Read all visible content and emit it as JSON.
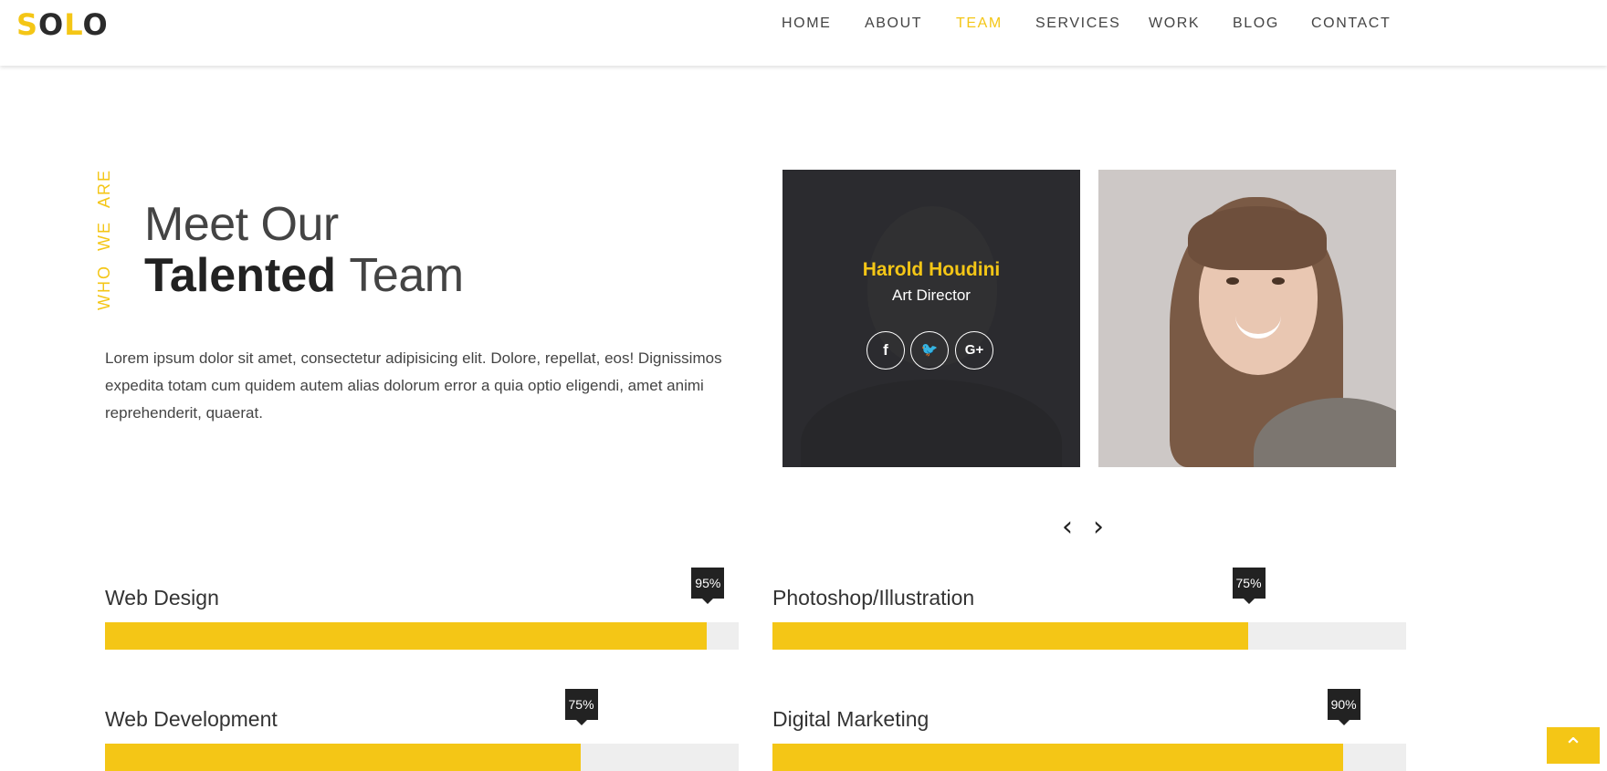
{
  "brand": {
    "letters": [
      "S",
      "O",
      "L",
      "O"
    ],
    "accent_color": "#f4c616"
  },
  "nav": {
    "items": [
      "HOME",
      "ABOUT",
      "TEAM",
      "SERVICES",
      "WORK",
      "BLOG",
      "CONTACT"
    ],
    "active": "TEAM"
  },
  "hero": {
    "kicker": "WHO WE ARE",
    "title_light_1": "Meet Our",
    "title_bold": "Talented",
    "title_light_2": "Team",
    "body": "Lorem ipsum dolor sit amet, consectetur adipisicing elit. Dolore, repellat, eos! Dignissimos expedita totam cum quidem autem alias dolorum error a quia optio eligendi, amet animi reprehenderit, quaerat."
  },
  "team": {
    "members": [
      {
        "name": "Harold Houdini",
        "role": "Art Director",
        "socials": [
          "facebook-icon",
          "twitter-icon",
          "google-plus-icon"
        ]
      }
    ],
    "social_glyphs": [
      "f",
      "🐦",
      "G+"
    ],
    "prev": "‹",
    "next": "›"
  },
  "skills": [
    {
      "label": "Web Design",
      "percent": 95,
      "badge": "95%"
    },
    {
      "label": "Photoshop/Illustration",
      "percent": 75,
      "badge": "75%"
    },
    {
      "label": "Web Development",
      "percent": 75,
      "badge": "75%"
    },
    {
      "label": "Digital Marketing",
      "percent": 90,
      "badge": "90%"
    }
  ],
  "scroll_top": "⌃"
}
